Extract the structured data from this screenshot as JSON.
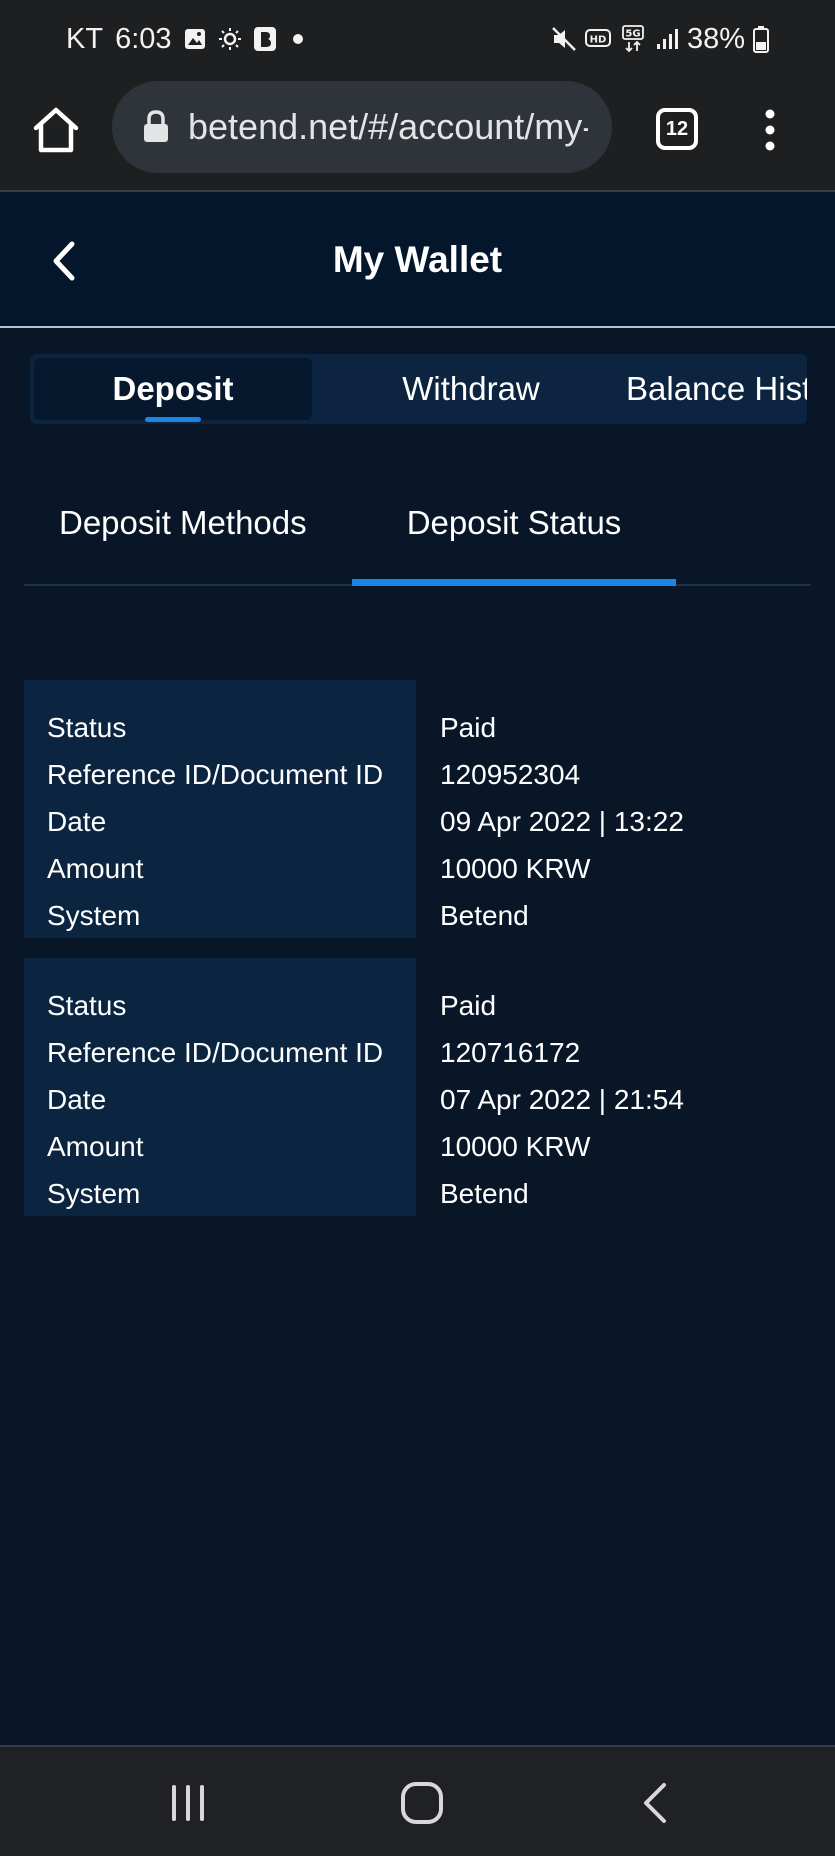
{
  "status_bar": {
    "carrier": "KT",
    "time": "6:03",
    "battery_percent": "38%",
    "icons_left": [
      "image-icon",
      "brightness-icon",
      "b-app-icon",
      "dot-icon"
    ],
    "icons_right": [
      "mute-icon",
      "hd-icon",
      "5g-icon",
      "signal-icon",
      "battery-icon"
    ]
  },
  "browser": {
    "url": "betend.net/#/account/my-wallet",
    "tab_count": "12"
  },
  "header": {
    "title": "My Wallet"
  },
  "main_tabs": [
    {
      "label": "Deposit",
      "active": true
    },
    {
      "label": "Withdraw",
      "active": false
    },
    {
      "label": "Balance History",
      "active": false
    }
  ],
  "sub_tabs": [
    {
      "label": "Deposit Methods",
      "active": false
    },
    {
      "label": "Deposit Status",
      "active": true
    }
  ],
  "record_labels": [
    "Status",
    "Reference ID/Document ID",
    "Date",
    "Amount",
    "System"
  ],
  "records": [
    {
      "status": "Paid",
      "reference_id": "120952304",
      "date": "09 Apr 2022 | 13:22",
      "amount": "10000 KRW",
      "system": "Betend"
    },
    {
      "status": "Paid",
      "reference_id": "120716172",
      "date": "07 Apr 2022 | 21:54",
      "amount": "10000 KRW",
      "system": "Betend"
    }
  ],
  "colors": {
    "background": "#081628",
    "header_background": "#04162b",
    "accent": "#1c84e6",
    "panel": "#0b2440"
  }
}
